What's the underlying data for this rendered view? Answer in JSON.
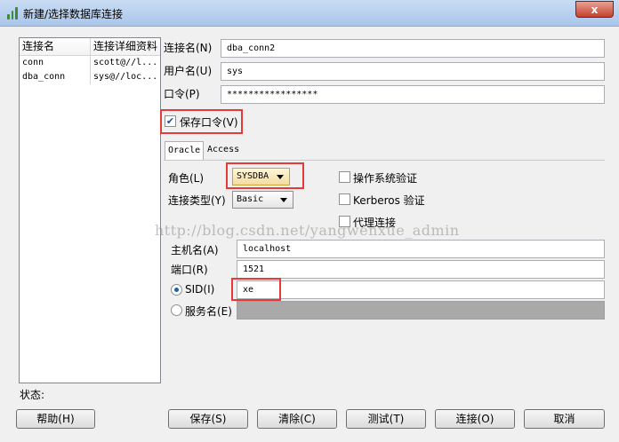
{
  "window": {
    "title": "新建/选择数据库连接",
    "close_label": "x"
  },
  "connections": {
    "headers": [
      "连接名",
      "连接详细资料"
    ],
    "rows": [
      {
        "name": "conn",
        "detail": "scott@//l..."
      },
      {
        "name": "dba_conn",
        "detail": "sys@//loc..."
      }
    ]
  },
  "status_label": "状态:",
  "form": {
    "conn_name_label": "连接名(N)",
    "conn_name_value": "dba_conn2",
    "user_label": "用户名(U)",
    "user_value": "sys",
    "password_label": "口令(P)",
    "password_value": "*****************",
    "save_password_label": "保存口令(V)",
    "save_password_checked": "✔"
  },
  "tabs": [
    {
      "label": "Oracle"
    },
    {
      "label": "Access"
    }
  ],
  "oracle": {
    "role_label": "角色(L)",
    "role_value": "SYSDBA",
    "conn_type_label": "连接类型(Y)",
    "conn_type_value": "Basic",
    "os_auth_label": "操作系统验证",
    "kerberos_label": "Kerberos 验证",
    "proxy_label": "代理连接",
    "host_label": "主机名(A)",
    "host_value": "localhost",
    "port_label": "端口(R)",
    "port_value": "1521",
    "sid_label": "SID(I)",
    "sid_value": "xe",
    "service_label": "服务名(E)"
  },
  "watermark": "http://blog.csdn.net/yangwenxue_admin",
  "buttons": {
    "help": "帮助(H)",
    "save": "保存(S)",
    "clear": "清除(C)",
    "test": "测试(T)",
    "connect": "连接(O)",
    "cancel": "取消"
  },
  "colors": {
    "highlight": "#e63a3a",
    "titlebar": "#b9d1ef"
  }
}
